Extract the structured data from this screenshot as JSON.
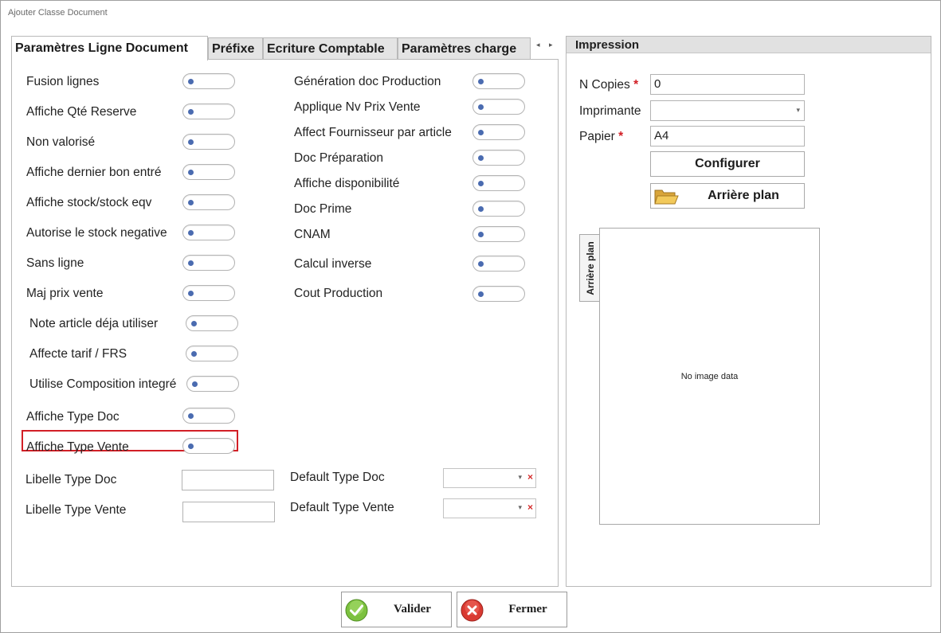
{
  "window": {
    "title": "Ajouter Classe Document"
  },
  "tabs": [
    {
      "label": "Paramètres Ligne Document",
      "active": true
    },
    {
      "label": "Préfixe",
      "active": false
    },
    {
      "label": "Ecriture Comptable",
      "active": false
    },
    {
      "label": "Paramètres charge",
      "active": false
    }
  ],
  "options_left": [
    {
      "label": "Fusion lignes",
      "value": false
    },
    {
      "label": "Affiche Qté Reserve",
      "value": false
    },
    {
      "label": "Non valorisé",
      "value": false
    },
    {
      "label": "Affiche dernier bon entré",
      "value": false
    },
    {
      "label": "Affiche stock/stock eqv",
      "value": false
    },
    {
      "label": "Autorise le stock negative",
      "value": false
    },
    {
      "label": "Sans ligne",
      "value": false
    },
    {
      "label": "Maj prix vente",
      "value": false
    },
    {
      "label": "Note article déja utiliser",
      "value": false
    },
    {
      "label": "Affecte tarif / FRS",
      "value": false
    },
    {
      "label": "Utilise Composition integré",
      "value": false
    },
    {
      "label": "Affiche Type Doc",
      "value": false
    },
    {
      "label": "Affiche Type Vente",
      "value": false
    }
  ],
  "options_right": [
    {
      "label": "Génération doc Production",
      "value": false
    },
    {
      "label": "Applique Nv Prix Vente",
      "value": false
    },
    {
      "label": "Affect Fournisseur par article",
      "value": false
    },
    {
      "label": "Doc Préparation",
      "value": false
    },
    {
      "label": "Affiche disponibilité",
      "value": false
    },
    {
      "label": "Doc Prime",
      "value": false
    },
    {
      "label": "CNAM",
      "value": false
    },
    {
      "label": "Calcul inverse",
      "value": false
    },
    {
      "label": "Cout Production",
      "value": false
    }
  ],
  "fields": {
    "libelle_type_doc": {
      "label": "Libelle Type Doc",
      "value": ""
    },
    "libelle_type_vente": {
      "label": "Libelle Type Vente",
      "value": ""
    },
    "default_type_doc": {
      "label": "Default Type Doc",
      "value": ""
    },
    "default_type_vente": {
      "label": "Default Type Vente",
      "value": ""
    }
  },
  "impression": {
    "title": "Impression",
    "copies_label": "N Copies",
    "copies_value": "0",
    "imprimante_label": "Imprimante",
    "imprimante_value": "",
    "papier_label": "Papier",
    "papier_value": "A4",
    "required_mark": "*",
    "configurer_label": "Configurer",
    "arriere_plan_label": "Arrière plan",
    "vertical_tab_label": "Arrière plan",
    "no_image_text": "No image data"
  },
  "buttons": {
    "valider": "Valider",
    "fermer": "Fermer"
  },
  "glyphs": {
    "tab_prev": "◂",
    "tab_next": "▸",
    "dropdown": "▾",
    "clear": "×"
  },
  "colors": {
    "toggle_knob": "#4a6bb0",
    "highlight": "#d21f26",
    "required": "#d21f26",
    "valider_icon": "#7cc13f",
    "fermer_icon": "#d93a32"
  }
}
